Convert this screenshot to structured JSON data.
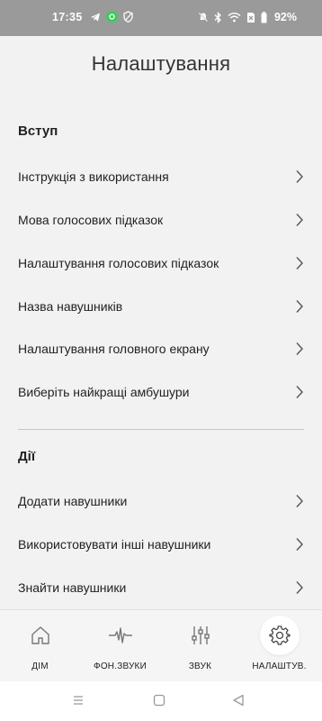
{
  "status": {
    "time": "17:35",
    "battery": "92%"
  },
  "title": "Налаштування",
  "sections": [
    {
      "title": "Вступ",
      "items": [
        "Інструкція з використання",
        "Мова голосових підказок",
        "Налаштування голосових підказок",
        "Назва навушників",
        "Налаштування головного екрану",
        "Виберіть найкращі амбушури"
      ]
    },
    {
      "title": "Дії",
      "items": [
        "Додати навушники",
        "Використовувати інші навушники",
        "Знайти навушники"
      ]
    }
  ],
  "nav": [
    {
      "label": "ДІМ",
      "icon": "home-icon"
    },
    {
      "label": "ФОН.ЗВУКИ",
      "icon": "ambient-sound-icon"
    },
    {
      "label": "ЗВУК",
      "icon": "equalizer-icon"
    },
    {
      "label": "НАЛАШТУВ.",
      "icon": "gear-icon",
      "active": true
    }
  ],
  "colors": {
    "statusbar": "#9a9a9a",
    "background": "#f2f2f2",
    "active_icon_bg": "#ffffff"
  }
}
